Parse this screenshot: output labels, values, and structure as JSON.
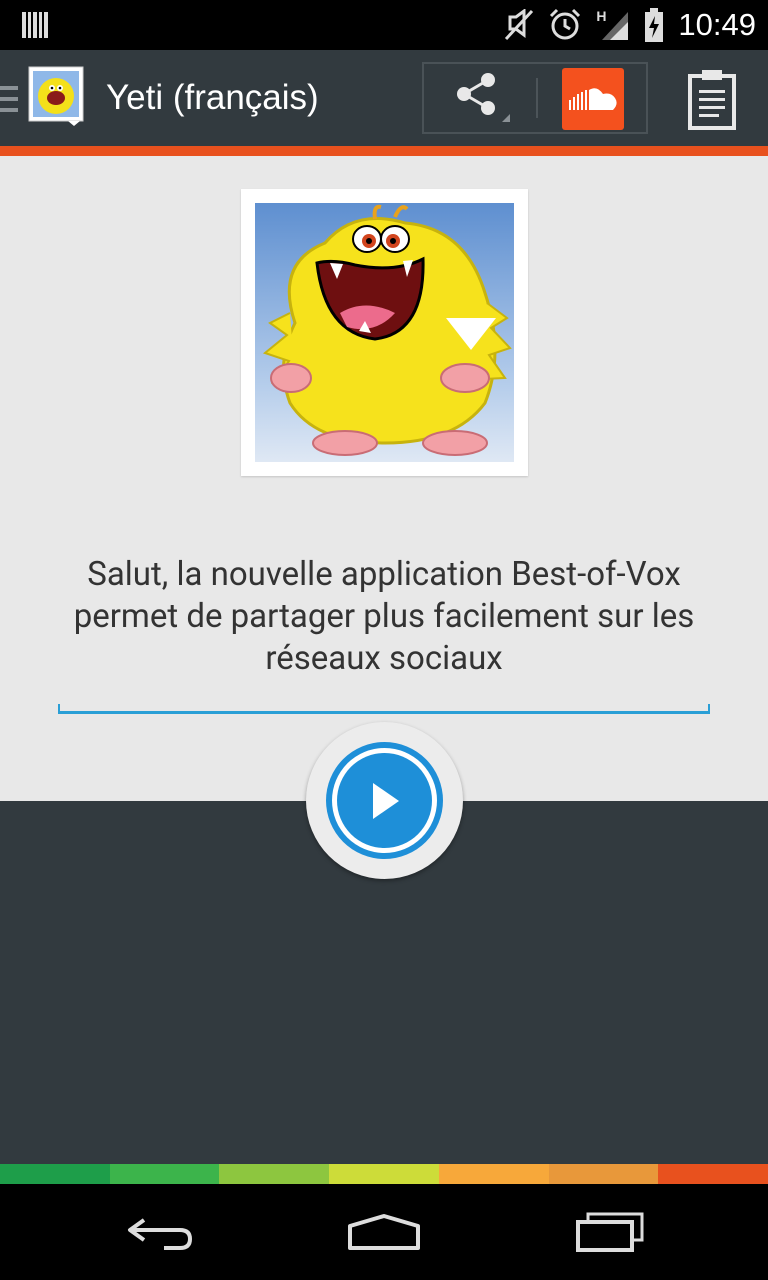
{
  "status_bar": {
    "time": "10:49",
    "network_label": "H",
    "icons": [
      "barcode-icon",
      "muted-icon",
      "alarm-icon",
      "signal-icon",
      "battery-icon"
    ]
  },
  "action_bar": {
    "title": "Yeti (français)",
    "icons": [
      "menu-icon",
      "app-icon",
      "share-icon",
      "soundcloud-icon",
      "clipboard-icon"
    ]
  },
  "content": {
    "message": "Salut, la nouvelle application Best-of-Vox permet de partager plus facilement sur les réseaux sociaux",
    "play_icon": "play-icon"
  },
  "color_strip": [
    "#1e9e4a",
    "#3cb44b",
    "#8dc63f",
    "#cddc39",
    "#f7a83a",
    "#e8983a",
    "#e8511e"
  ],
  "nav_bar": {
    "icons": [
      "back-icon",
      "home-icon",
      "recents-icon"
    ]
  },
  "colors": {
    "action_bar": "#323a3f",
    "accent_orange": "#e8511e",
    "accent_blue": "#1e8fd8",
    "soundcloud": "#f4511e",
    "content_bg": "#e8e8e8"
  }
}
